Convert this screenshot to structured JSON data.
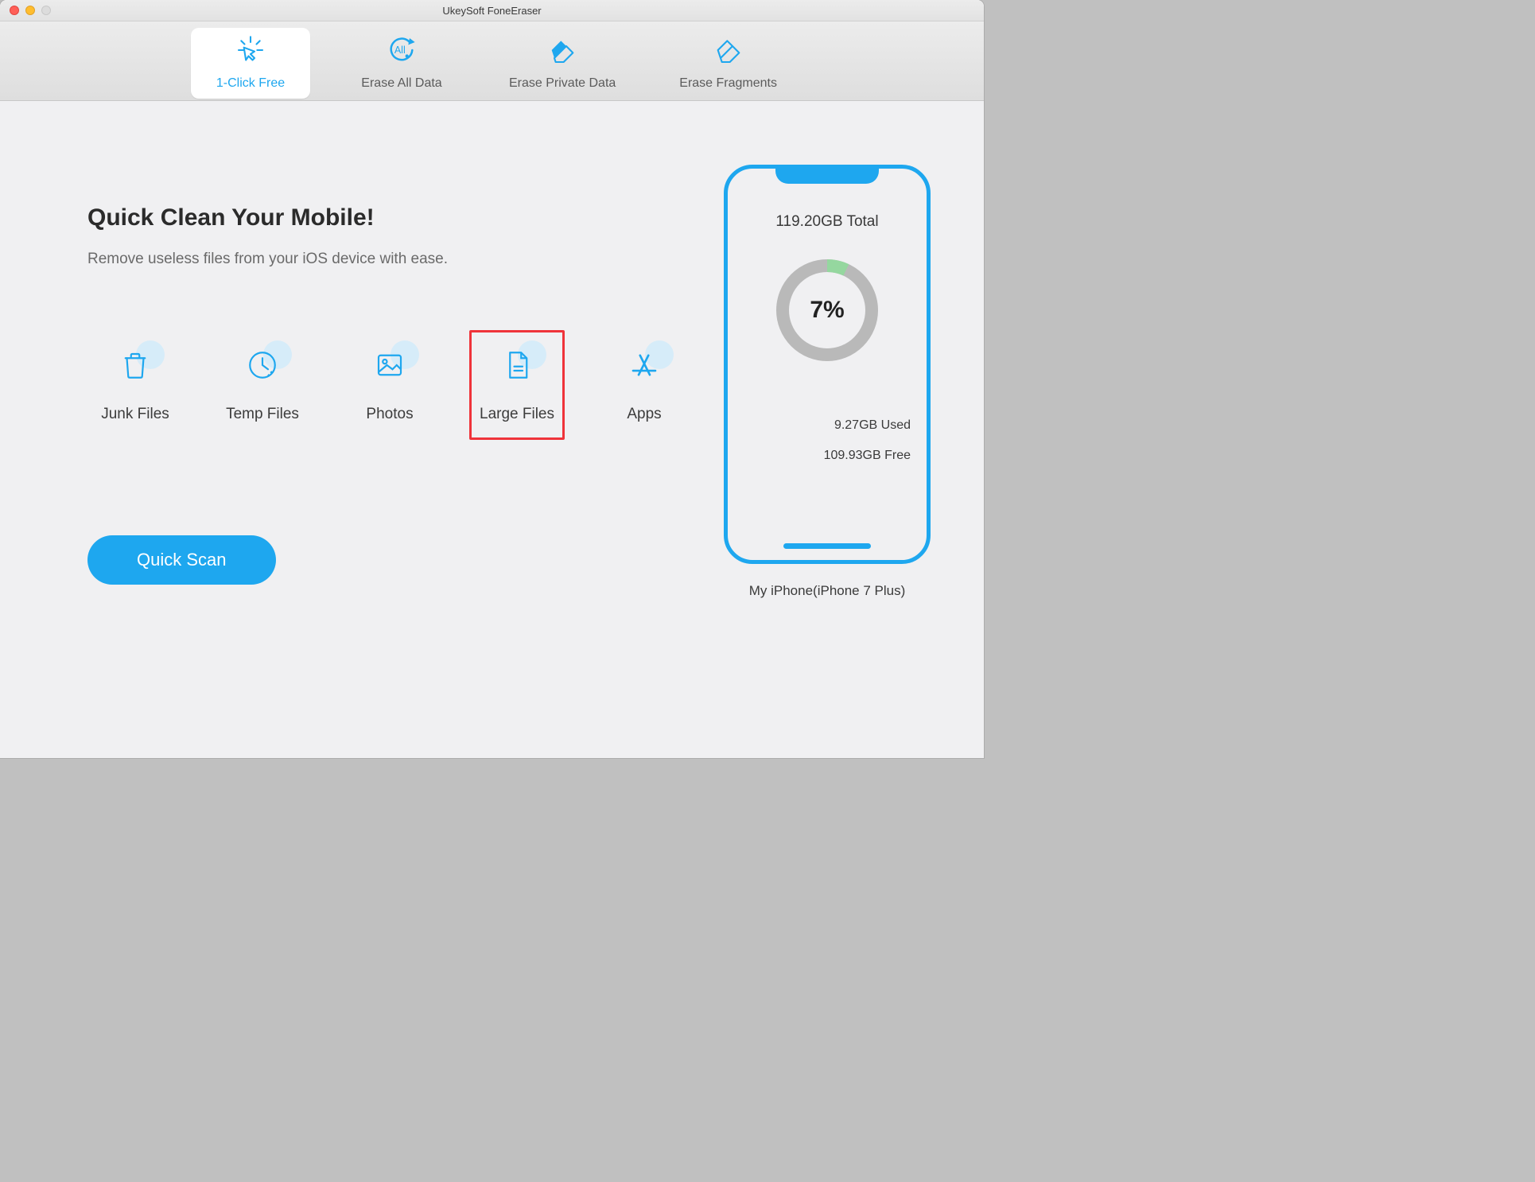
{
  "window": {
    "title": "UkeySoft FoneEraser"
  },
  "tabs": {
    "click_free": "1-Click Free",
    "erase_all": "Erase All Data",
    "erase_private": "Erase Private Data",
    "erase_fragments": "Erase Fragments"
  },
  "main": {
    "heading": "Quick Clean Your Mobile!",
    "subheading": "Remove useless files from your iOS device with ease.",
    "categories": {
      "junk": "Junk Files",
      "temp": "Temp Files",
      "photos": "Photos",
      "large": "Large Files",
      "apps": "Apps"
    },
    "cta": "Quick Scan"
  },
  "device": {
    "total": "119.20GB Total",
    "percent": "7%",
    "used": "9.27GB Used",
    "free": "109.93GB Free",
    "name": "My iPhone(iPhone 7 Plus)"
  },
  "chart_data": {
    "type": "pie",
    "title": "Storage usage",
    "series": [
      {
        "name": "Used",
        "value_gb": 9.27,
        "percent": 7
      },
      {
        "name": "Free",
        "value_gb": 109.93,
        "percent": 93
      }
    ],
    "total_gb": 119.2
  },
  "colors": {
    "accent": "#1ea7ef",
    "highlight": "#ef333a",
    "donut_used": "#95d79f",
    "donut_free": "#b9b9b9"
  }
}
